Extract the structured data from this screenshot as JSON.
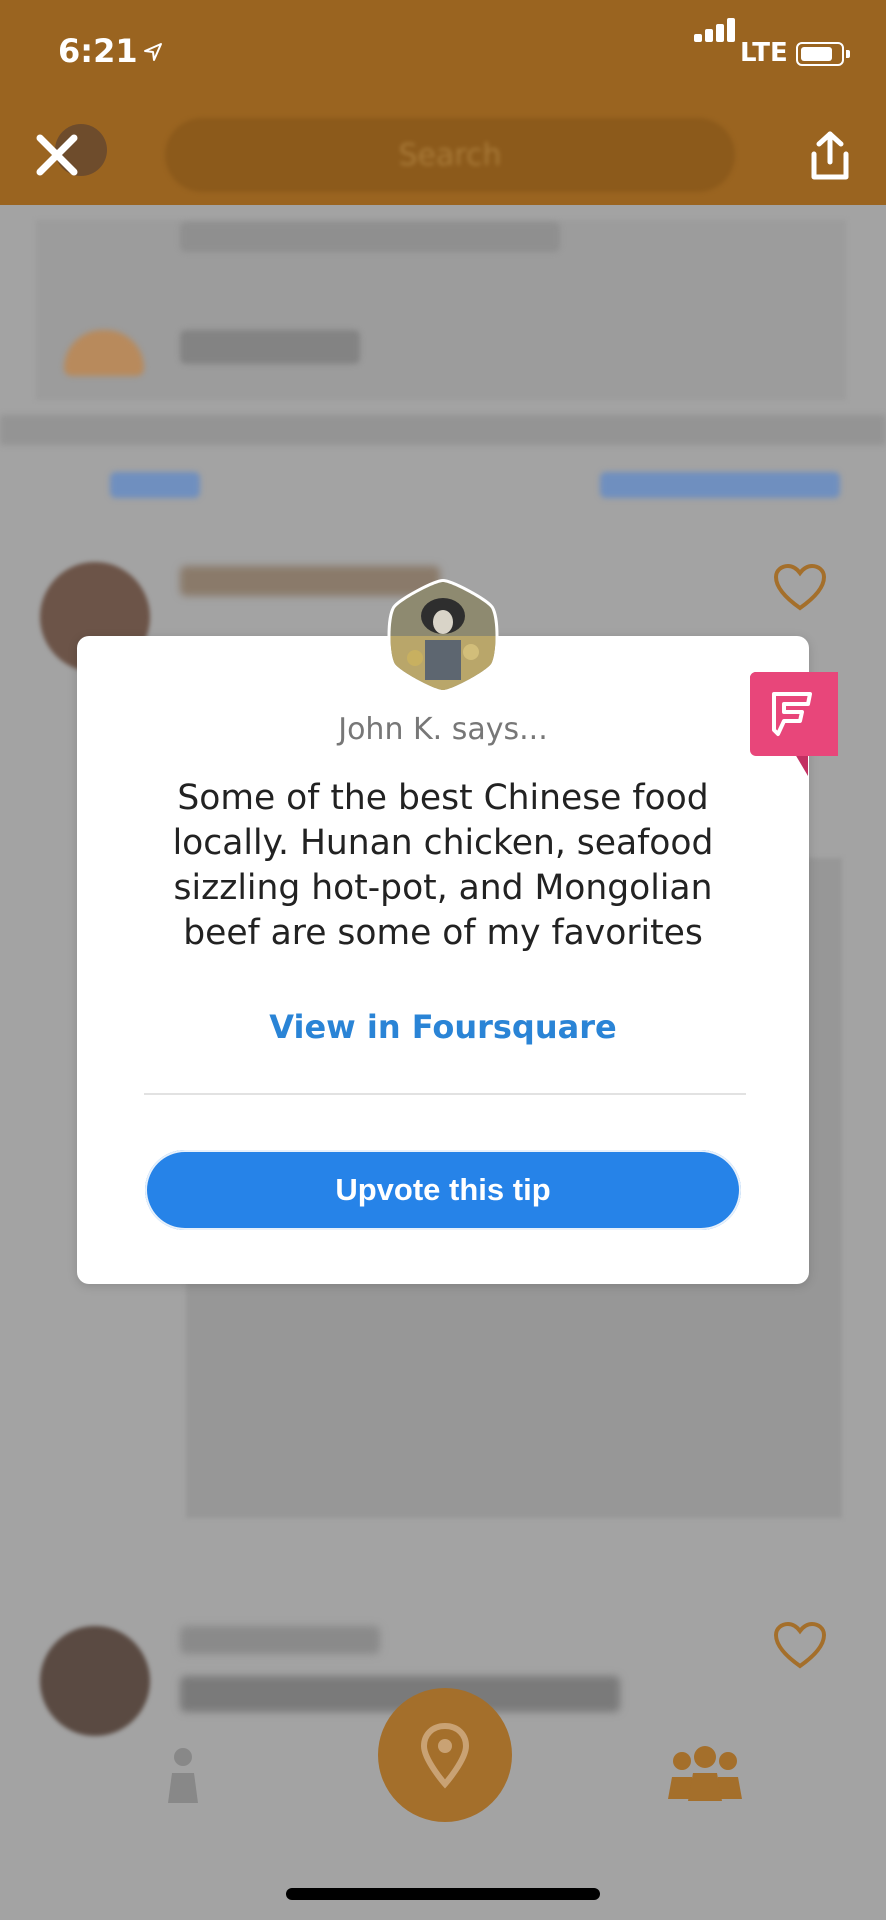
{
  "status_bar": {
    "time": "6:21",
    "network": "LTE"
  },
  "header": {
    "search_placeholder": "Search"
  },
  "tip_modal": {
    "author_says": "John K. says...",
    "tip_text": "Some of the best Chinese food locally.  Hunan chicken, seafood sizzling hot-pot, and Mongolian beef are some of my favorites",
    "view_link_label": "View in Foursquare",
    "upvote_button_label": "Upvote this tip",
    "badge_icon": "foursquare-icon"
  },
  "colors": {
    "header_dim": "#9a6420",
    "upvote_blue": "#2683e8",
    "link_blue": "#2a84d6",
    "foursquare_pink": "#e8467a"
  }
}
